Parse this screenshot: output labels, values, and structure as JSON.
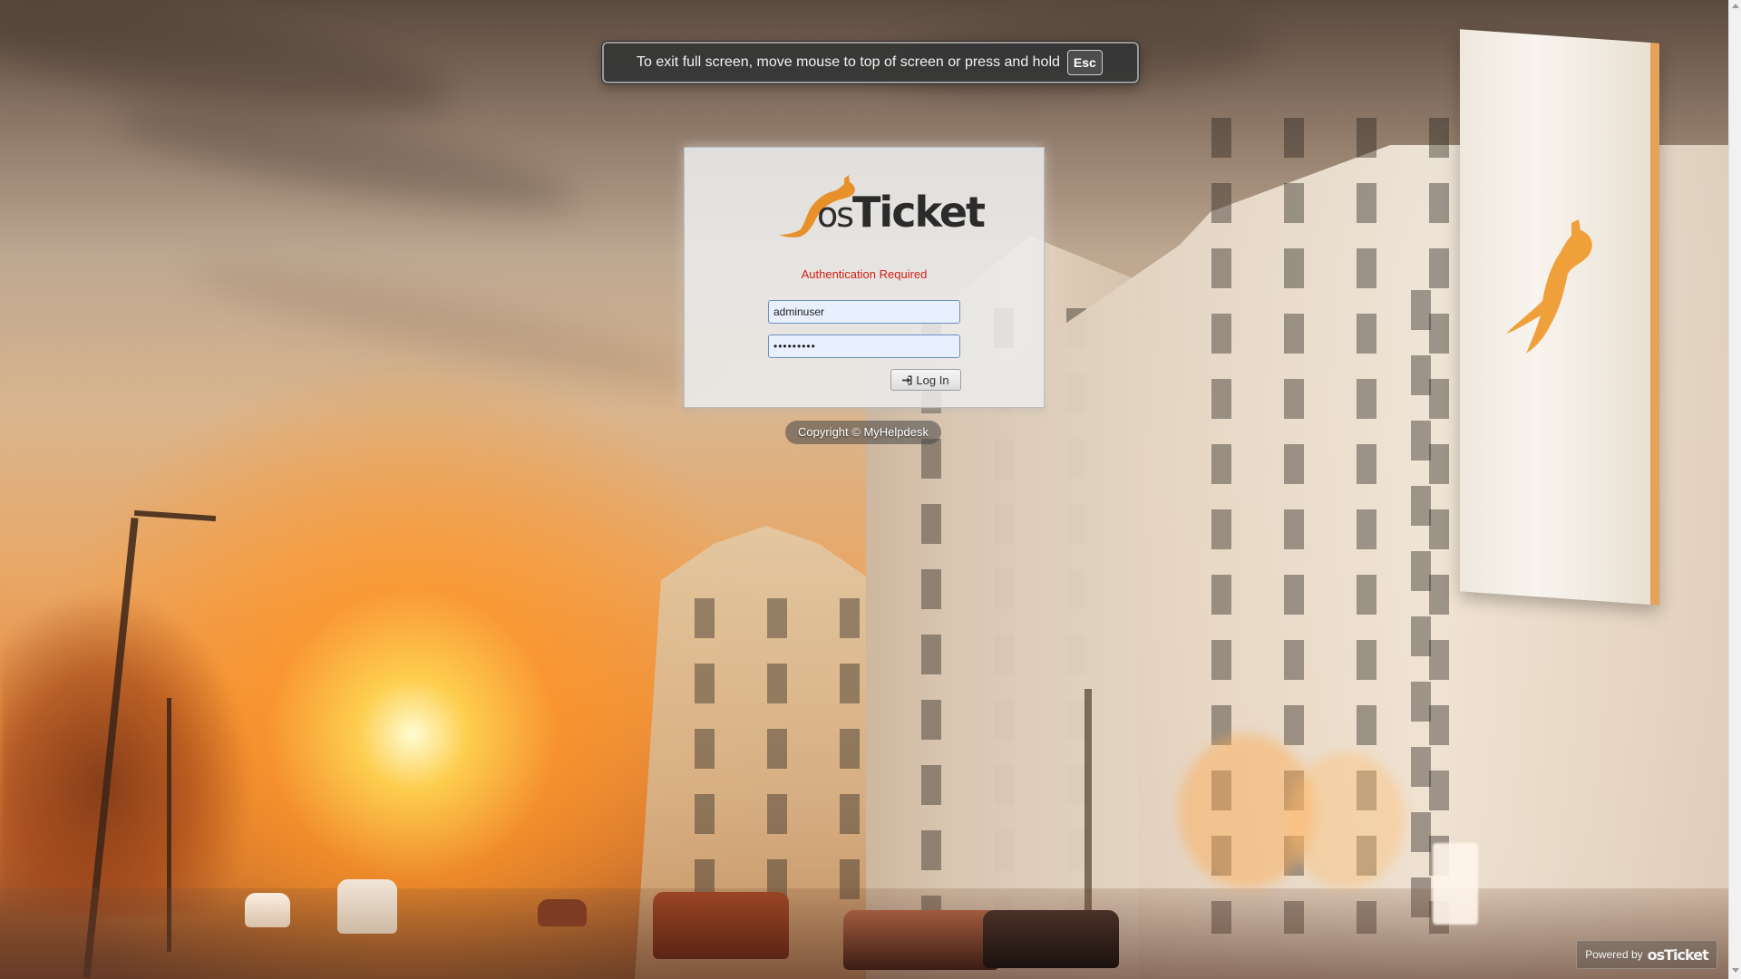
{
  "fullscreen_notice": {
    "message": "To exit full screen, move mouse to top of screen or press and hold",
    "key": "Esc"
  },
  "login": {
    "logo_text_os": "os",
    "logo_text_ticket": "Ticket",
    "auth_message": "Authentication Required",
    "username_value": "adminuser",
    "password_value": "•••••••••",
    "login_button_label": "Log In",
    "login_icon": "sign-in-icon"
  },
  "footer": {
    "copyright": "Copyright © MyHelpdesk",
    "powered_by_label": "Powered by",
    "powered_by_brand": "osTicket"
  },
  "colors": {
    "error_red": "#d22016",
    "brand_orange": "#e8912b",
    "input_bg": "#e8f0fe"
  }
}
